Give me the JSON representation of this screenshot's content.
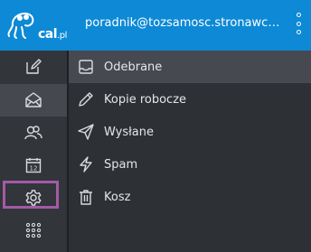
{
  "header": {
    "logo_text": "cal",
    "logo_suffix": ".pl",
    "account": "poradnik@tozsamosc.stronawca..."
  },
  "sidebar": {
    "items": [
      {
        "icon": "compose-icon"
      },
      {
        "icon": "mail-icon",
        "active": true
      },
      {
        "icon": "contacts-icon"
      },
      {
        "icon": "calendar-icon",
        "calendar_day": "12"
      },
      {
        "icon": "gear-icon",
        "highlighted": true
      },
      {
        "icon": "apps-grid-icon"
      }
    ]
  },
  "folders": [
    {
      "label": "Odebrane",
      "icon": "inbox-icon",
      "active": true
    },
    {
      "label": "Kopie robocze",
      "icon": "pencil-icon"
    },
    {
      "label": "Wysłane",
      "icon": "paper-plane-icon"
    },
    {
      "label": "Spam",
      "icon": "lightning-icon"
    },
    {
      "label": "Kosz",
      "icon": "trash-icon"
    }
  ],
  "colors": {
    "header_bg": "#0d89d6",
    "highlight": "#a45aa6",
    "text": "#e4e6ea"
  }
}
